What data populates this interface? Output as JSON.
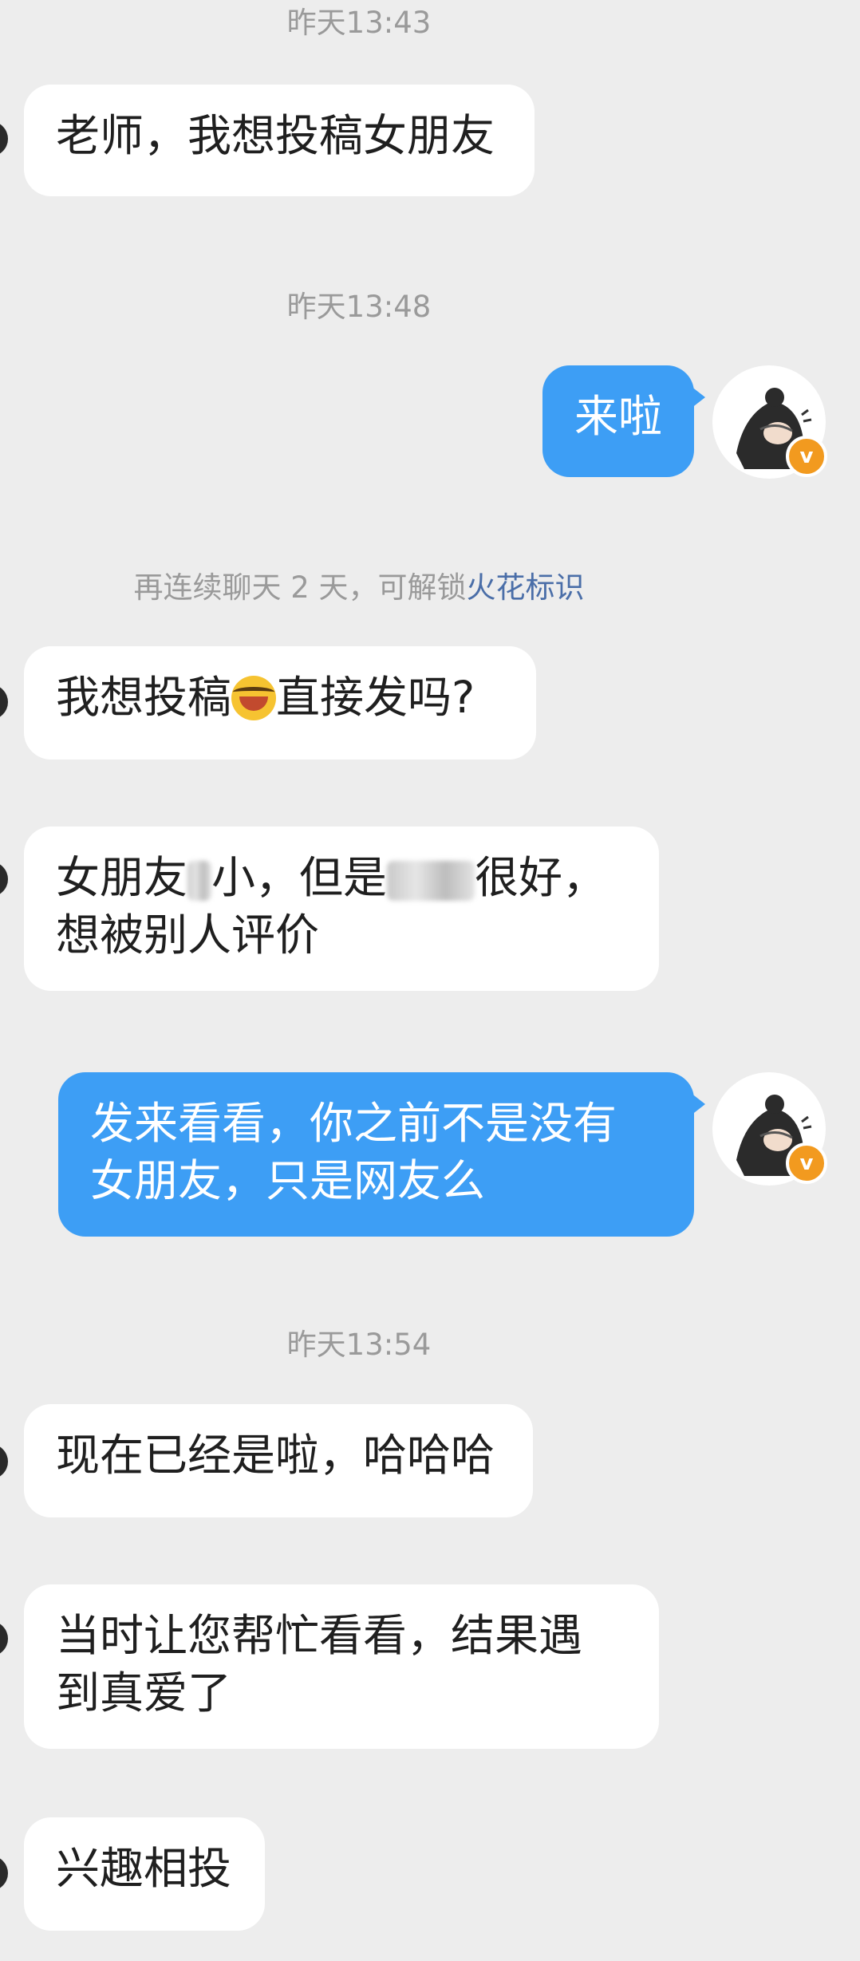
{
  "messages": {
    "ts1": "昨天13:43",
    "m1": "老师，我想投稿女朋友",
    "ts2": "昨天13:48",
    "m2": "来啦",
    "sys_prefix": "再连续聊天 2 天，可解锁",
    "sys_link": "火花标识",
    "m3_a": "我想投稿",
    "m3_b": "直接发吗?",
    "m4_a": "女朋友",
    "m4_b": "小，但是",
    "m4_c": "很好，",
    "m4_line2": "想被别人评价",
    "m5_line1": "发来看看，你之前不是没有",
    "m5_line2": "女朋友，只是网友么",
    "ts3": "昨天13:54",
    "m6": "现在已经是啦，哈哈哈",
    "m7_line1": "当时让您帮忙看看，结果遇",
    "m7_line2": "到真爱了",
    "m8": "兴趣相投"
  },
  "badge_icon": "v-verified-icon",
  "avatar_icon": "cartoon-character-avatar",
  "colors": {
    "background": "#ededed",
    "incoming_bubble": "#ffffff",
    "outgoing_bubble": "#3d9ef5",
    "link": "#4a6ea8",
    "badge": "#f29a1f"
  }
}
